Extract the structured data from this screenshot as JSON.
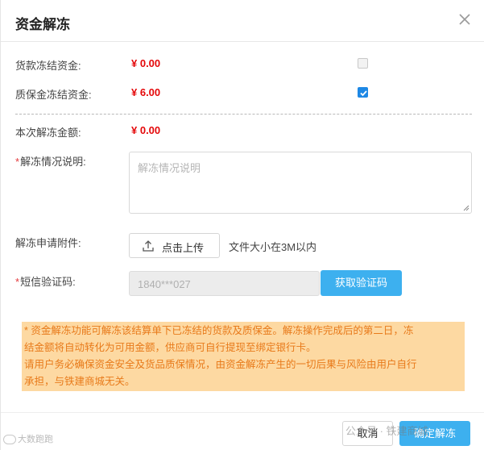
{
  "dialog": {
    "title": "资金解冻"
  },
  "rows": {
    "goods_frozen": {
      "label": "货款冻结资金:",
      "amount": "¥ 0.00",
      "checked": false
    },
    "deposit_frozen": {
      "label": "质保金冻结资金:",
      "amount": "¥ 6.00",
      "checked": true
    },
    "this_unfreeze": {
      "label": "本次解冻金额:",
      "amount": "¥ 0.00"
    }
  },
  "form": {
    "desc_label": "解冻情况说明:",
    "desc_placeholder": "解冻情况说明",
    "attach_label": "解冻申请附件:",
    "upload_label": "点击上传",
    "upload_hint": "文件大小在3M以内",
    "sms_label": "短信验证码:",
    "phone_value": "1840***027",
    "get_code_label": "获取验证码",
    "required_mark": "*"
  },
  "notice": {
    "line1": "* 资金解冻功能可解冻该结算单下已冻结的货款及质保金。解冻操作完成后的第二日，冻",
    "line2": "结金额将自动转化为可用金额，供应商可自行提现至绑定银行卡。",
    "line3": "请用户务必确保资金安全及货品质保情况，由资金解冻产生的一切后果与风险由用户自行",
    "line4": "承担，与铁建商城无关。"
  },
  "footer": {
    "cancel_label": "取消",
    "confirm_label": "确定解冻"
  },
  "watermarks": {
    "bottom_left": "大数跑跑",
    "center": "公众号 · 铁建商城"
  },
  "colors": {
    "accent": "#3db0ef",
    "amount": "#e4080a",
    "notice_bg": "#fdd9a2",
    "notice_text": "#e87a1a"
  }
}
